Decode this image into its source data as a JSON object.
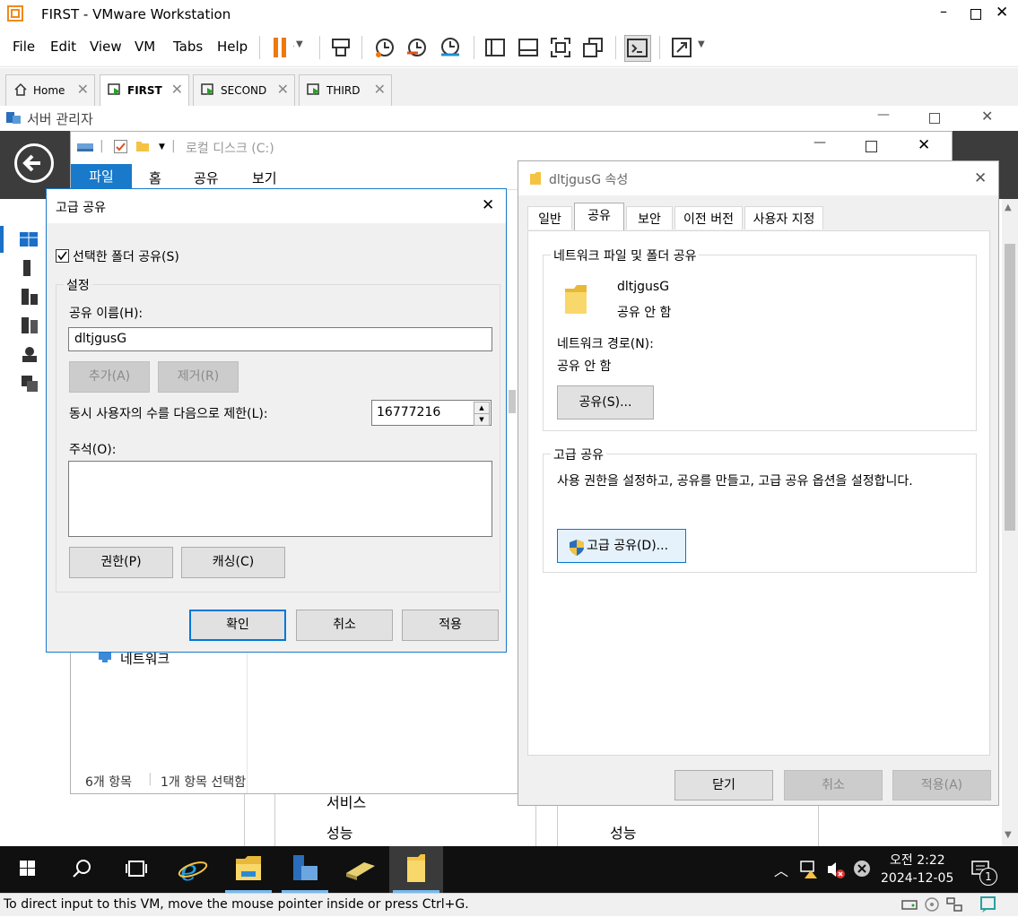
{
  "vmware": {
    "title": "FIRST - VMware Workstation",
    "menu": [
      "File",
      "Edit",
      "View",
      "VM",
      "Tabs",
      "Help"
    ],
    "tabs": [
      {
        "label": "Home",
        "active": false
      },
      {
        "label": "FIRST",
        "active": true
      },
      {
        "label": "SECOND",
        "active": false
      },
      {
        "label": "THIRD",
        "active": false
      }
    ],
    "status_text": "To direct input to this VM, move the mouse pointer inside or press Ctrl+G."
  },
  "server_manager": {
    "title": "서버 관리자"
  },
  "explorer": {
    "title": "로컬 디스크 (C:)",
    "ribbon_tabs": [
      "파일",
      "홈",
      "공유",
      "보기"
    ],
    "nav_item": "네트워크",
    "status_items": "6개 항목",
    "status_selected": "1개 항목 선택함",
    "bg_text_1": "서비스",
    "bg_text_2": "성능",
    "bg_text_3": "성능"
  },
  "advanced_sharing": {
    "title": "고급 공유",
    "share_checkbox": "선택한 폴더 공유(S)",
    "settings_group": "설정",
    "share_name_label": "공유 이름(H):",
    "share_name_value": "dltjgusG",
    "add_button": "추가(A)",
    "remove_button": "제거(R)",
    "limit_label": "동시 사용자의 수를 다음으로 제한(L):",
    "limit_value": "16777216",
    "comment_label": "주석(O):",
    "permissions_button": "권한(P)",
    "caching_button": "캐싱(C)",
    "ok_button": "확인",
    "cancel_button": "취소",
    "apply_button": "적용"
  },
  "properties": {
    "title": "dltjgusG 속성",
    "tabs": [
      "일반",
      "공유",
      "보안",
      "이전 버전",
      "사용자 지정"
    ],
    "network_group": "네트워크 파일 및 폴더 공유",
    "folder_name": "dltjgusG",
    "folder_state": "공유 안 함",
    "network_path_label": "네트워크 경로(N):",
    "network_path_value": "공유 안 함",
    "share_button": "공유(S)...",
    "advanced_group": "고급 공유",
    "advanced_desc": "사용 권한을 설정하고, 공유를 만들고, 고급 공유 옵션을 설정합니다.",
    "advanced_button": "고급 공유(D)...",
    "close_button": "닫기",
    "cancel_button": "취소",
    "apply_button": "적용(A)"
  },
  "taskbar": {
    "time": "오전 2:22",
    "date": "2024-12-05",
    "notification_count": "1"
  }
}
